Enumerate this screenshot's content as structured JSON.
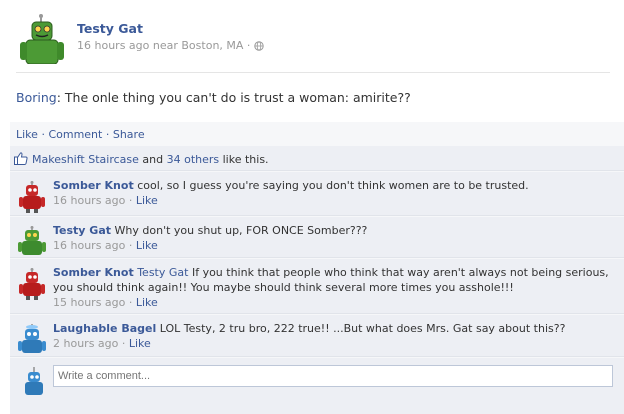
{
  "post": {
    "author": "Testy Gat",
    "time": "16 hours ago",
    "location_prefix": "near",
    "location": "Boston, MA",
    "meta_dot": "·",
    "globe_icon": "globe-icon",
    "body_tag": "Boring",
    "body_sep": ":",
    "body_text": " The onle thing you can't do is trust a woman: amirite??"
  },
  "actions": {
    "like": "Like",
    "comment": "Comment",
    "share": "Share",
    "dot": "·"
  },
  "likes": {
    "thumb_icon": "thumbs-up-icon",
    "name": "Makeshift Staircase",
    "and": "and",
    "others": "34 others",
    "tail": "like this."
  },
  "comments": [
    {
      "name": "Somber Knot",
      "mention": "",
      "text": "cool, so I guess you're saying you don't think women are to be trusted.",
      "time": "16 hours ago",
      "like": "Like",
      "avatar_color": "#c62828"
    },
    {
      "name": "Testy Gat",
      "mention": "",
      "text": "Why don't you shut up, FOR ONCE Somber???",
      "time": "16 hours ago",
      "like": "Like",
      "avatar_color": "#3d8b2e"
    },
    {
      "name": "Somber Knot",
      "mention": "Testy Gat",
      "text": "If you think that people who think that way aren't always not being serious, you should think again!! You maybe should think several more times you asshole!!!",
      "time": "15 hours ago",
      "like": "Like",
      "avatar_color": "#c62828"
    },
    {
      "name": "Laughable Bagel",
      "mention": "",
      "text": "LOL Testy, 2 tru bro, 222 true!! ...But what does Mrs. Gat say about this??",
      "time": "2 hours ago",
      "like": "Like",
      "avatar_color": "#3a8ccf"
    }
  ],
  "write": {
    "placeholder": "Write a comment..."
  },
  "colors": {
    "link": "#3b5998",
    "feedback_bg": "#edeff4",
    "green": "#3d8b2e",
    "red": "#c62828",
    "blue": "#3a8ccf"
  }
}
